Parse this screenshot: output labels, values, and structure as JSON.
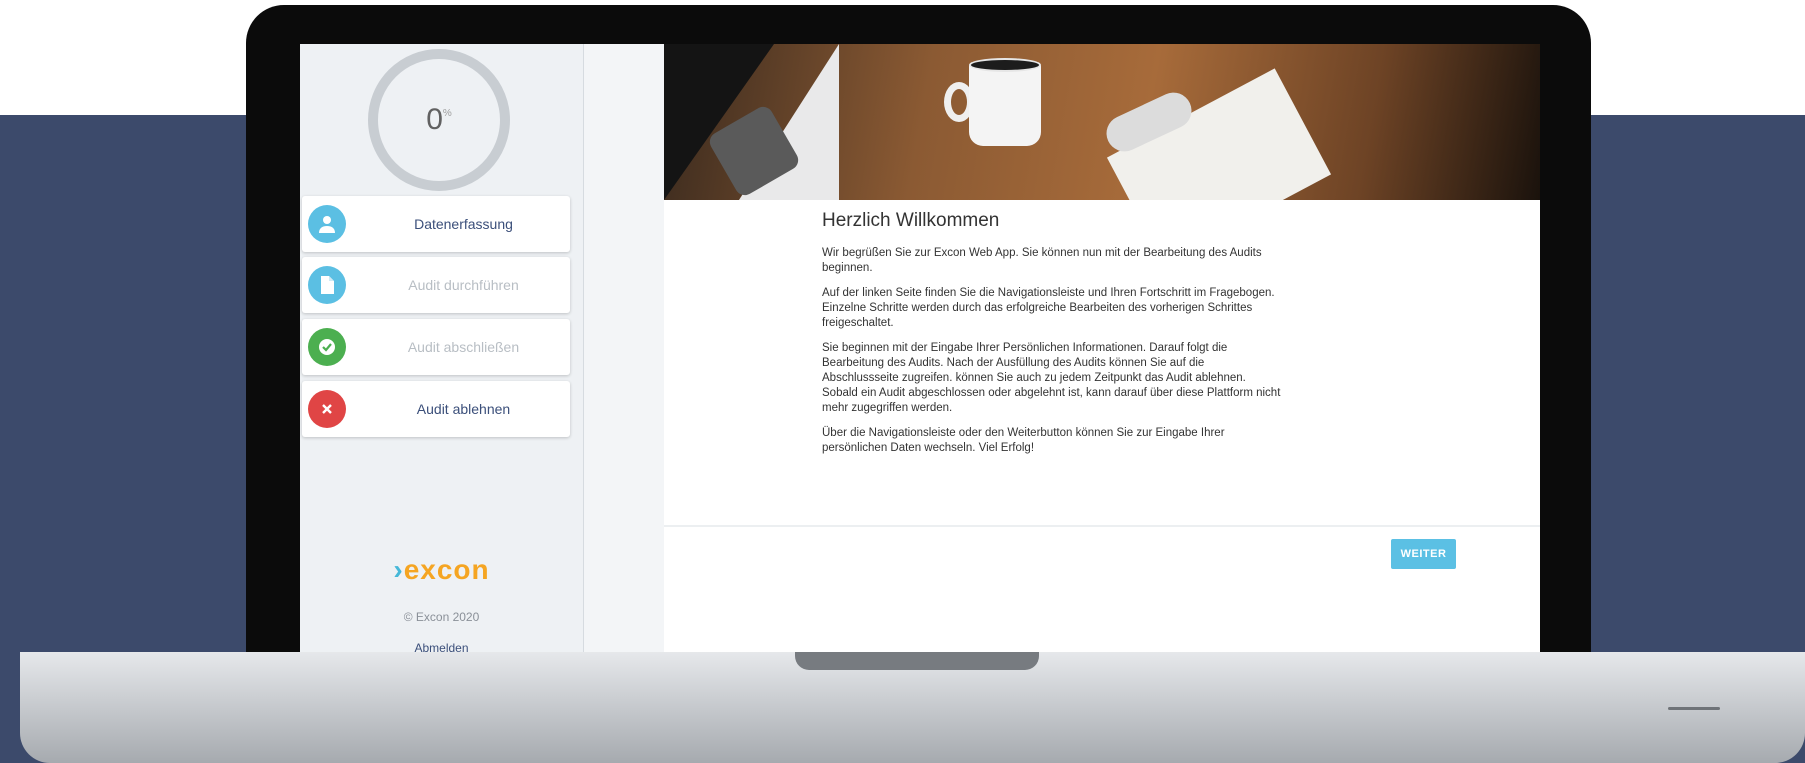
{
  "sidebar": {
    "progress": {
      "value": "0",
      "unit": "%"
    },
    "items": [
      {
        "label": "Datenerfassung",
        "icon": "user-icon",
        "color": "#5bbfe3",
        "state": "active"
      },
      {
        "label": "Audit durchführen",
        "icon": "document-icon",
        "color": "#5bbfe3",
        "state": "disabled"
      },
      {
        "label": "Audit abschließen",
        "icon": "check-icon",
        "color": "#4caf50",
        "state": "disabled"
      },
      {
        "label": "Audit ablehnen",
        "icon": "close-icon",
        "color": "#e04545",
        "state": "active"
      }
    ],
    "logo": {
      "mark": "›",
      "text": "excon"
    },
    "copyright": "© Excon 2020",
    "logout": "Abmelden"
  },
  "main": {
    "title": "Herzlich Willkommen",
    "paragraphs": [
      "Wir begrüßen Sie zur Excon Web App. Sie können nun mit der Bearbeitung des Audits beginnen.",
      "Auf der linken Seite finden Sie die Navigationsleiste und Ihren Fortschritt im Fragebogen. Einzelne Schritte werden durch das erfolgreiche Bearbeiten des vorherigen Schrittes freigeschaltet.",
      "Sie beginnen mit der Eingabe Ihrer Persönlichen Informationen. Darauf folgt die Bearbeitung des Audits. Nach der Ausfüllung des Audits können Sie auf die Abschlussseite zugreifen. können Sie auch zu jedem Zeitpunkt das Audit ablehnen. Sobald ein Audit abgeschlossen oder abgelehnt ist, kann darauf über diese Plattform nicht mehr zugegriffen werden.",
      "Über die Navigationsleiste oder den Weiterbutton können Sie zur Eingabe Ihrer persönlichen Daten wechseln. Viel Erfolg!"
    ],
    "next_button": "WEITER"
  },
  "colors": {
    "accent": "#5bc0e4",
    "brand_orange": "#f5a522",
    "background": "#3c4a6b"
  }
}
